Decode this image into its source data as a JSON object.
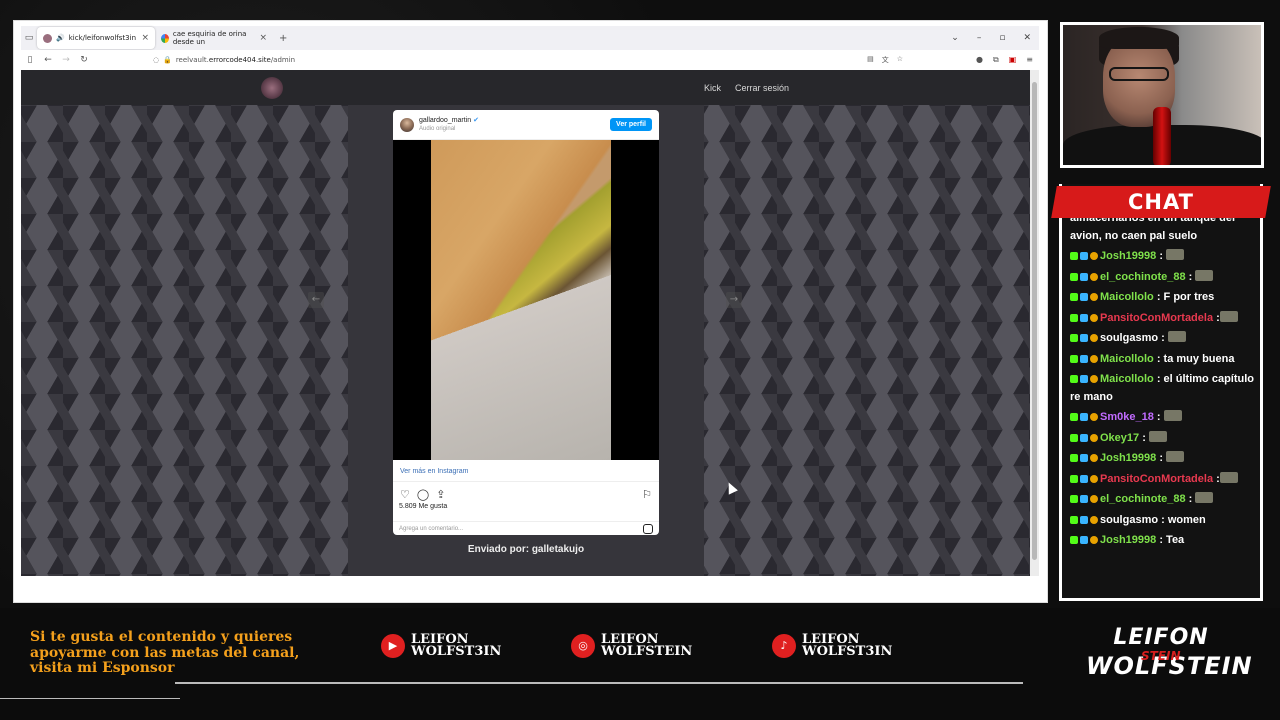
{
  "browser": {
    "tabs": [
      {
        "label": "kick/leifonwolfst3in",
        "active": true
      },
      {
        "label": "cae esquiria de orina desde un",
        "active": false
      }
    ],
    "url_prefix": "reelvault.",
    "url_domain": "errorcode404.site",
    "url_path": "/admin"
  },
  "site": {
    "nav": [
      {
        "label": "Kick"
      },
      {
        "label": "Cerrar sesión"
      }
    ],
    "sender_text": "Enviado por: galletakujo"
  },
  "instagram": {
    "username": "gallardoo_martin",
    "subtitle": "Audio original",
    "profile_button": "Ver perfil",
    "view_more": "Ver más en Instagram",
    "likes": "5.809 Me gusta",
    "comment_placeholder": "Agrega un comentario..."
  },
  "chat": {
    "title": "CHAT",
    "messages": [
      {
        "user": "",
        "text": "almacernarlos en un tanque del avion, no caen pal suelo",
        "color": "#ffffff"
      },
      {
        "user": "Josh19998",
        "text": " : ",
        "color": "#7fe14b"
      },
      {
        "user": "el_cochinote_88",
        "text": " : ",
        "color": "#7fe14b"
      },
      {
        "user": "Maicollolo",
        "text": " : F por tres",
        "color": "#7fe14b"
      },
      {
        "user": "PansitoConMortadela",
        "text": " :",
        "color": "#e8394f"
      },
      {
        "user": "soulgasmo",
        "text": " : ",
        "color": "#ffffff"
      },
      {
        "user": "Maicollolo",
        "text": " : ta muy buena",
        "color": "#7fe14b"
      },
      {
        "user": "Maicollolo",
        "text": " : el último capítulo re mano",
        "color": "#7fe14b"
      },
      {
        "user": "Sm0ke_18",
        "text": " : ",
        "color": "#c16bff"
      },
      {
        "user": "Okey17",
        "text": " : ",
        "color": "#7fe14b"
      },
      {
        "user": "Josh19998",
        "text": " : ",
        "color": "#7fe14b"
      },
      {
        "user": "PansitoConMortadela",
        "text": " :",
        "color": "#e8394f"
      },
      {
        "user": "el_cochinote_88",
        "text": " : ",
        "color": "#7fe14b"
      },
      {
        "user": "soulgasmo",
        "text": " : women",
        "color": "#ffffff"
      },
      {
        "user": "Josh19998",
        "text": " : Tea",
        "color": "#7fe14b"
      }
    ]
  },
  "footer": {
    "sponsor_text": "Si te gusta el contenido y quieres apoyarme con las metas del canal, visita mi Esponsor",
    "socials": [
      {
        "icon": "youtube-icon",
        "line1": "LEIFON",
        "line2": "WOLFST3IN"
      },
      {
        "icon": "instagram-icon",
        "line1": "LEIFON",
        "line2": "WOLFSTEIN"
      },
      {
        "icon": "tiktok-icon",
        "line1": "LEIFON",
        "line2": "WOLFST3IN"
      }
    ],
    "brand_line1": "LEIFON",
    "brand_line2": "WOLFSTEIN",
    "brand_overlay": "STEIN",
    "sponsor_color": "#f4a01c",
    "accent": "#d71a1a"
  }
}
